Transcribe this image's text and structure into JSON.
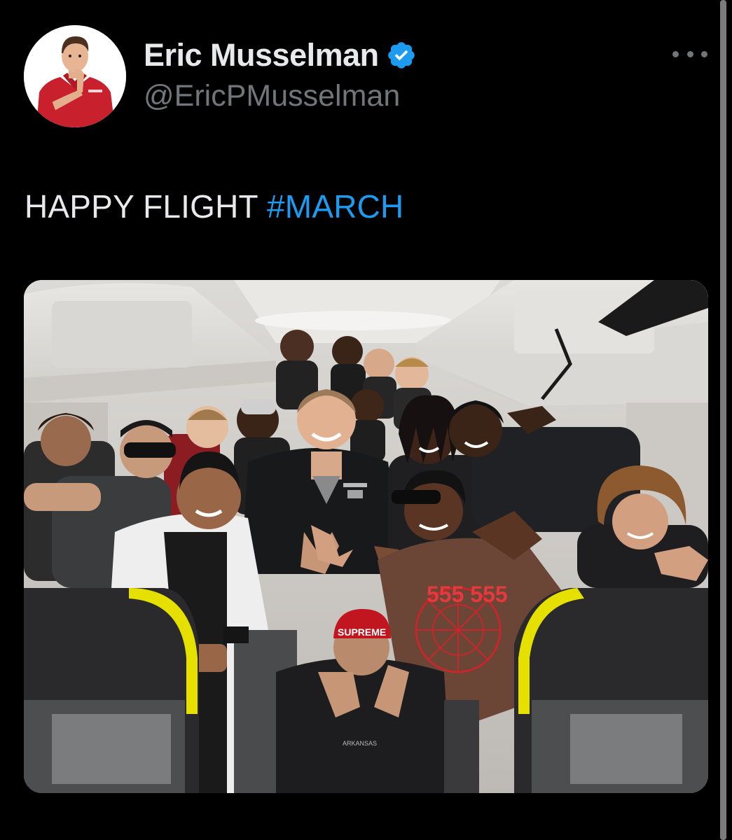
{
  "author": {
    "display_name": "Eric Musselman",
    "handle": "@EricPMusselman",
    "verified": true,
    "avatar_icon": "cartoon-coach-avatar"
  },
  "tweet": {
    "text": "HAPPY FLIGHT",
    "hashtag": "#MARCH"
  },
  "media": {
    "description_icon": "team-photo-airplane-cabin",
    "cap_text": "SUPREME",
    "hoodie_text": "555 555",
    "jacket_text": "ARKANSAS"
  },
  "icons": {
    "more": "more-options-icon",
    "verified": "verified-badge-icon"
  },
  "colors": {
    "background": "#000000",
    "primary_text": "#e7e9ea",
    "secondary_text": "#71767b",
    "accent": "#1d9bf0"
  }
}
